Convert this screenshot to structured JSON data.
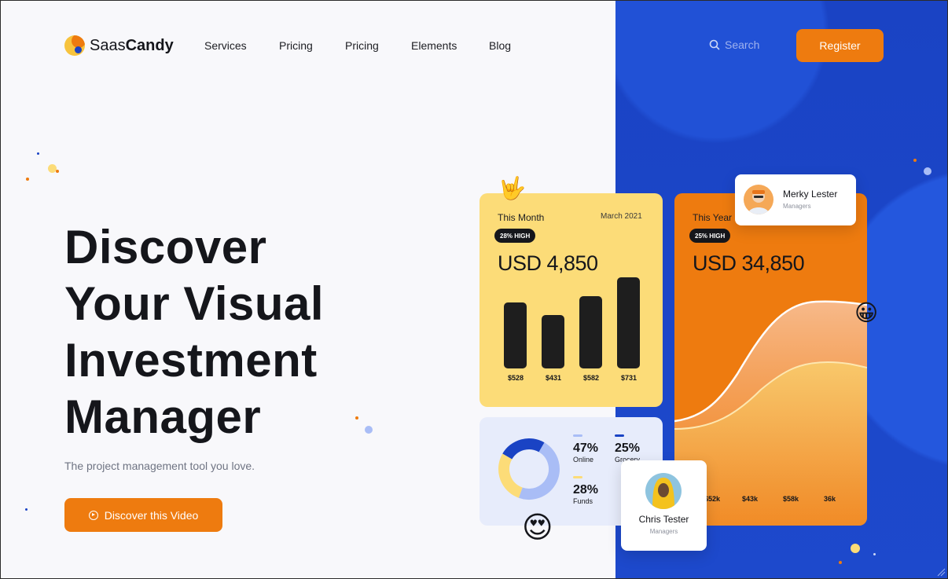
{
  "brand": {
    "name_light": "Saas",
    "name_bold": "Candy"
  },
  "nav": {
    "items": [
      "Services",
      "Pricing",
      "Pricing",
      "Elements",
      "Blog"
    ]
  },
  "header": {
    "search_placeholder": "Search",
    "register_label": "Register"
  },
  "hero": {
    "title_lines": [
      "Discover",
      "Your Visual",
      "Investment",
      "Manager"
    ],
    "subtitle": "The project management tool you love.",
    "cta_label": "Discover this Video"
  },
  "month_card": {
    "label": "This Month",
    "date": "March 2021",
    "badge": "28% HIGH",
    "amount": "USD 4,850",
    "bars": [
      {
        "label": "$528",
        "value": 528
      },
      {
        "label": "$431",
        "value": 431
      },
      {
        "label": "$582",
        "value": 582
      },
      {
        "label": "$731",
        "value": 731
      }
    ]
  },
  "year_card": {
    "label": "This Year",
    "badge": "25% HIGH",
    "amount": "USD 34,850",
    "ticks": [
      "$52k",
      "$43k",
      "$58k",
      "36k"
    ]
  },
  "donut_card": {
    "segments": [
      {
        "pct": "47%",
        "name": "Online",
        "value": 47,
        "color": "#a9bdf6"
      },
      {
        "pct": "25%",
        "name": "Grocery",
        "value": 25,
        "color": "#1a43c4"
      },
      {
        "pct": "28%",
        "name": "Funds",
        "value": 28,
        "color": "#fcdc78"
      }
    ]
  },
  "profiles": {
    "merky": {
      "name": "Merky Lester",
      "role": "Managers"
    },
    "chris": {
      "name": "Chris Tester",
      "role": "Managers"
    }
  },
  "colors": {
    "accent": "#ee7b0f",
    "blue": "#1a43c4",
    "yellow": "#fcdc78",
    "dark": "#15161b"
  },
  "emojis": {
    "rock": "🤟",
    "grin": "😀",
    "heart_eyes": "😍"
  }
}
